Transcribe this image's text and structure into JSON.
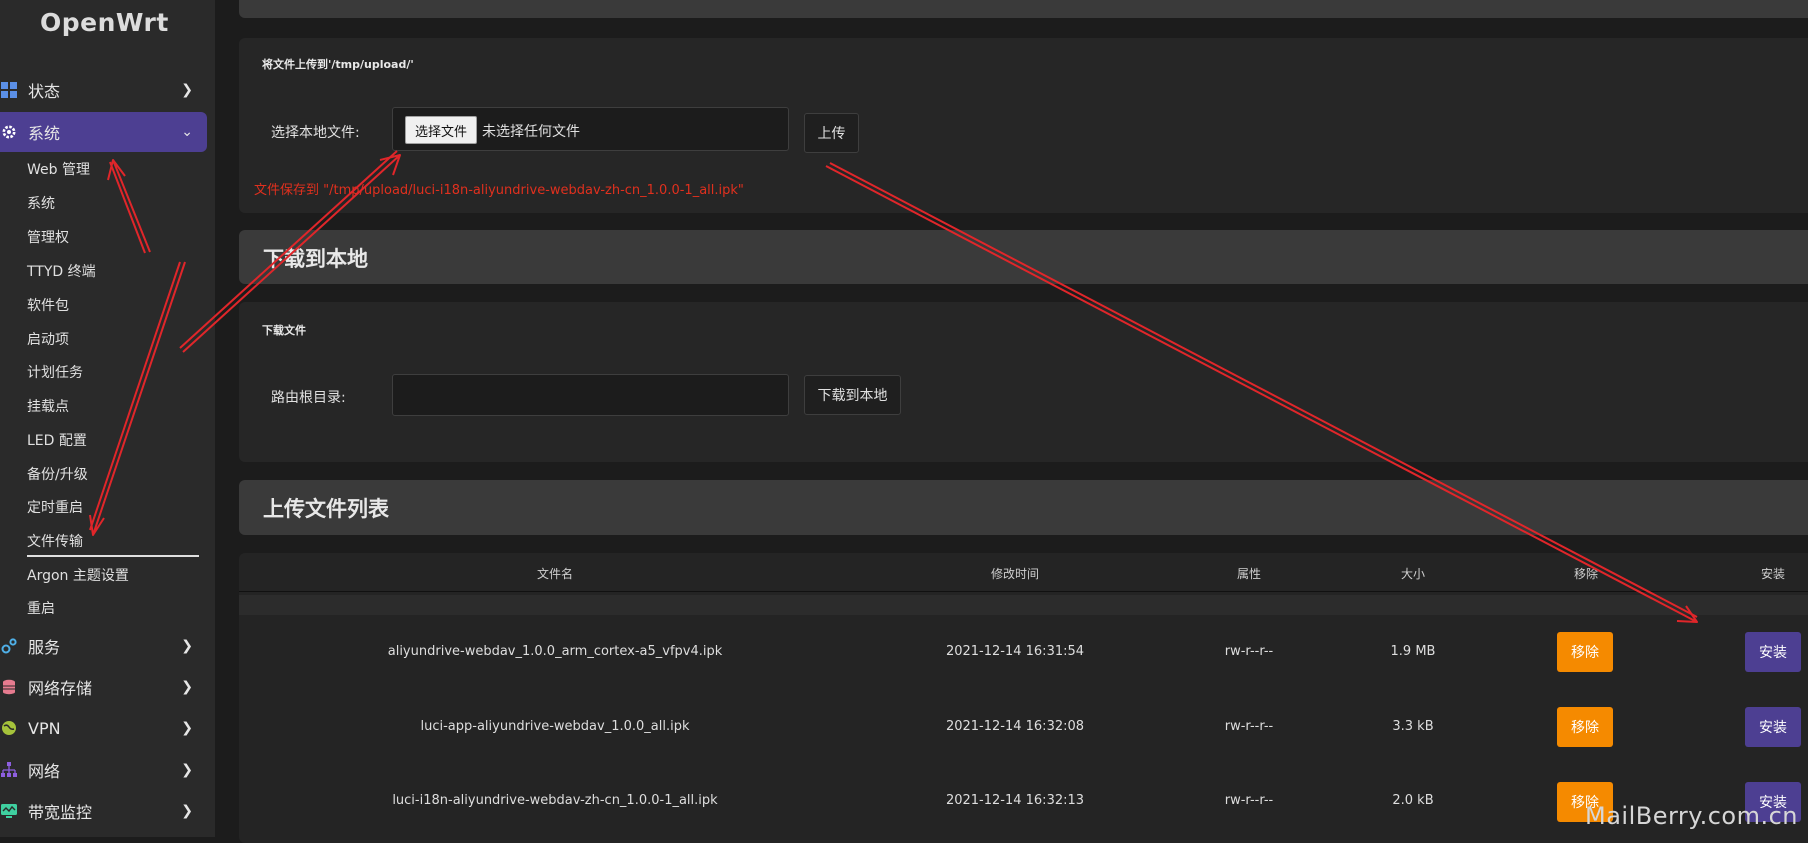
{
  "app": {
    "logo": "OpenWrt"
  },
  "sidebar": {
    "top_items": [
      {
        "label": "状态",
        "icon": "dashboard-icon",
        "active": false
      },
      {
        "label": "系统",
        "icon": "gear-icon",
        "active": true
      },
      {
        "label": "服务",
        "icon": "services-icon",
        "active": false
      },
      {
        "label": "网络存储",
        "icon": "storage-icon",
        "active": false
      },
      {
        "label": "VPN",
        "icon": "globe-icon",
        "active": false
      },
      {
        "label": "网络",
        "icon": "network-icon",
        "active": false
      },
      {
        "label": "带宽监控",
        "icon": "monitor-icon",
        "active": false
      }
    ],
    "sub_items": [
      "Web 管理",
      "系统",
      "管理权",
      "TTYD 终端",
      "软件包",
      "启动项",
      "计划任务",
      "挂载点",
      "LED 配置",
      "备份/升级",
      "定时重启",
      "文件传输",
      "Argon 主题设置",
      "重启"
    ],
    "selected_sub": "文件传输"
  },
  "upload": {
    "title": "将文件上传到'/tmp/upload/'",
    "field_label": "选择本地文件:",
    "choose_button": "选择文件",
    "no_file_text": "未选择任何文件",
    "upload_button": "上传",
    "saved_note": "文件保存到 \"/tmp/upload/luci-i18n-aliyundrive-webdav-zh-cn_1.0.0-1_all.ipk\""
  },
  "download": {
    "header": "下载到本地",
    "title": "下载文件",
    "field_label": "路由根目录:",
    "input_value": "",
    "button": "下载到本地"
  },
  "file_list": {
    "header": "上传文件列表",
    "columns": [
      "文件名",
      "修改时间",
      "属性",
      "大小",
      "移除",
      "安装"
    ],
    "remove_label": "移除",
    "install_label": "安装",
    "rows": [
      {
        "name": "aliyundrive-webdav_1.0.0_arm_cortex-a5_vfpv4.ipk",
        "mtime": "2021-12-14 16:31:54",
        "attr": "rw-r--r--",
        "size": "1.9 MB"
      },
      {
        "name": "luci-app-aliyundrive-webdav_1.0.0_all.ipk",
        "mtime": "2021-12-14 16:32:08",
        "attr": "rw-r--r--",
        "size": "3.3 kB"
      },
      {
        "name": "luci-i18n-aliyundrive-webdav-zh-cn_1.0.0-1_all.ipk",
        "mtime": "2021-12-14 16:32:13",
        "attr": "rw-r--r--",
        "size": "2.0 kB"
      }
    ]
  },
  "watermark": "MailBerry.com.cn",
  "colors": {
    "accent": "#4d3f92",
    "remove": "#f58a00",
    "note": "#e0301e",
    "annotation": "#e0262a"
  }
}
